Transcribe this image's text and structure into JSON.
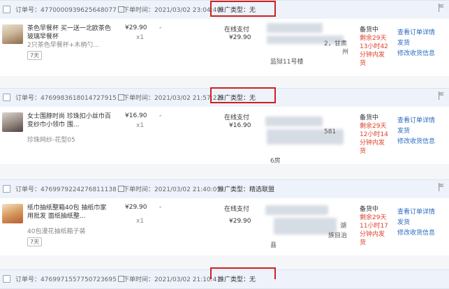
{
  "labels": {
    "order_no": "订单号：",
    "order_time": "下单时间：",
    "promo_type": "推广类型：",
    "dash": "-",
    "status": "备货中",
    "link_detail": "查看订单详情",
    "link_ship": "发货",
    "link_address": "修改收货信息"
  },
  "orders": [
    {
      "order_id": "4770000939625648077",
      "order_time": "2021/03/02 23:04:40",
      "promo": "无",
      "product_title": "茶色早餐杯 买一送一北欧茶色玻璃早餐杯",
      "sku": "2只茶色早餐杯+木柄勺...",
      "tag": "7天",
      "price": "¥29.90",
      "qty": "x1",
      "pay_method": "在线支付",
      "total": "¥29.90",
      "addr_frag_1": "2，甘肃",
      "addr_frag_2": "州",
      "addr_frag_3": "监狱11号楼",
      "countdown": "剩余29天13小时42分钟内发货"
    },
    {
      "order_id": "4769983618014727915",
      "order_time": "2021/03/02 21:57:22",
      "promo": "无",
      "product_title": "女士围脖时尚 珍珠扣小丝巾百变纱巾小领巾 围...",
      "sku": "珍珠网纱-花型05",
      "tag": "7天",
      "price": "¥16.90",
      "qty": "x1",
      "pay_method": "在线支付",
      "total": "¥16.90",
      "addr_frag_1": "581",
      "addr_frag_2": "",
      "addr_frag_3": "6房",
      "countdown": "剩余29天12小时14分钟内发货"
    },
    {
      "order_id": "4769979224276811138",
      "order_time": "2021/03/02 21:40:05",
      "promo": "精选联盟",
      "product_title": "纸巾抽纸整箱40包 抽纸巾家用批发 面纸抽纸整...",
      "sku": "40包漫花抽纸箱子装",
      "tag": "7天",
      "price": "¥29.90",
      "qty": "x1",
      "pay_method": "在线支付",
      "total": "¥29.90",
      "addr_frag_1": "湖",
      "addr_frag_2": "族目治",
      "addr_frag_3": "县",
      "countdown": "剩余29天11小时17分钟内发货"
    },
    {
      "order_id": "4769971557750723695",
      "order_time": "2021/03/02 21:10:41",
      "promo": "无"
    }
  ],
  "colors": {
    "header_bg": "#eef3fb",
    "link": "#2b6bbf",
    "countdown": "#e0402a",
    "highlight_box": "#cc2222"
  }
}
